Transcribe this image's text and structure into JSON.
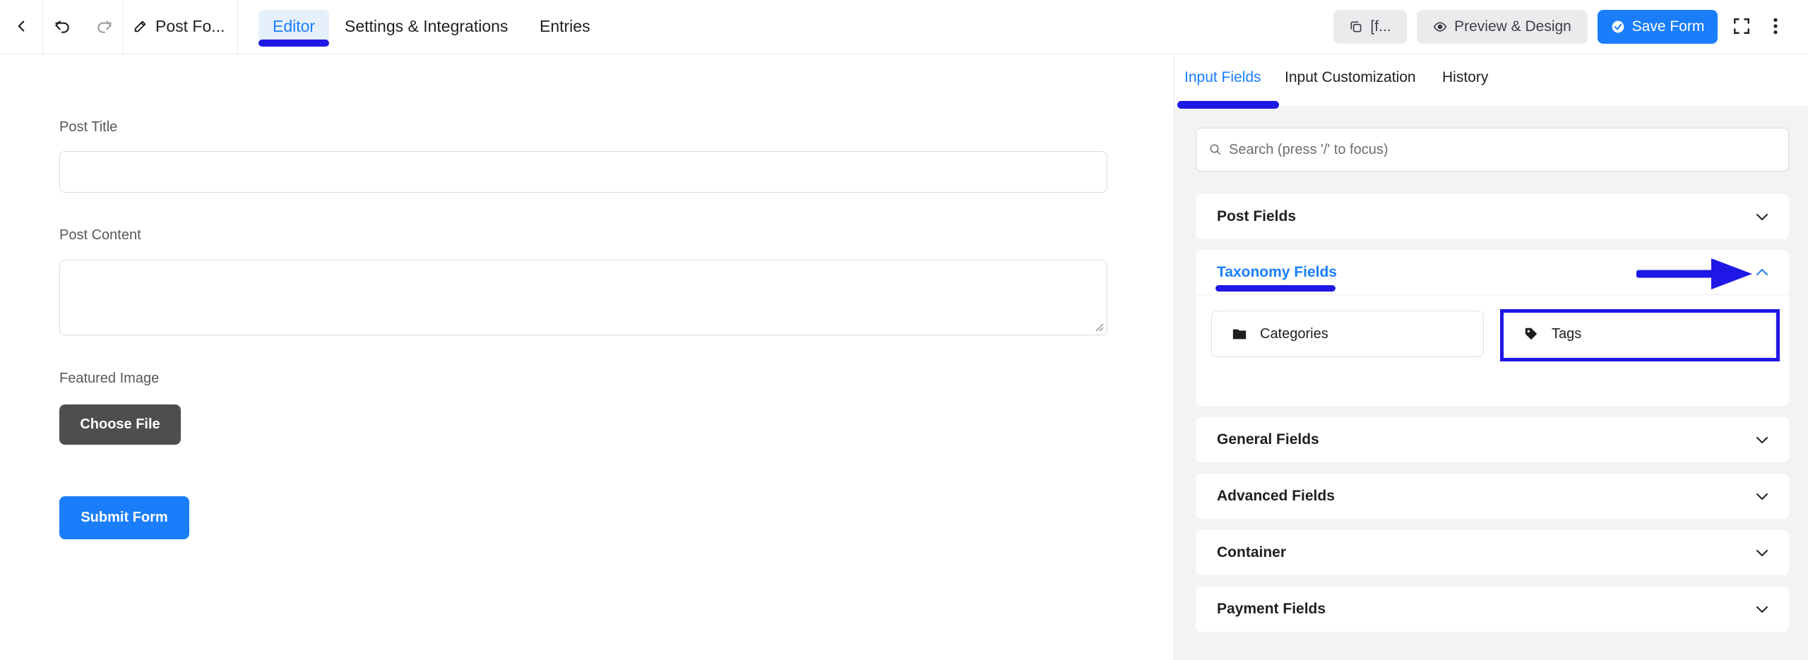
{
  "topbar": {
    "form_title": "Post Fo...",
    "tabs": [
      {
        "label": "Editor",
        "active": true
      },
      {
        "label": "Settings & Integrations",
        "active": false
      },
      {
        "label": "Entries",
        "active": false
      }
    ],
    "shortcode_label": "[f...",
    "preview_label": "Preview & Design",
    "save_label": "Save Form"
  },
  "editor": {
    "fields": [
      {
        "label": "Post Title",
        "type": "text",
        "value": ""
      },
      {
        "label": "Post Content",
        "type": "textarea",
        "value": ""
      },
      {
        "label": "Featured Image",
        "type": "file"
      }
    ],
    "file_button_label": "Choose File",
    "submit_label": "Submit Form"
  },
  "sidebar": {
    "tabs": [
      {
        "label": "Input Fields",
        "active": true
      },
      {
        "label": "Input Customization",
        "active": false
      },
      {
        "label": "History",
        "active": false
      }
    ],
    "search_placeholder": "Search (press '/' to focus)",
    "sections": [
      {
        "title": "Post Fields",
        "expanded": false
      },
      {
        "title": "Taxonomy Fields",
        "expanded": true,
        "items": [
          {
            "label": "Categories",
            "icon": "folder-icon"
          },
          {
            "label": "Tags",
            "icon": "tag-icon",
            "highlighted": true
          }
        ]
      },
      {
        "title": "General Fields",
        "expanded": false
      },
      {
        "title": "Advanced Fields",
        "expanded": false
      },
      {
        "title": "Container",
        "expanded": false
      },
      {
        "title": "Payment Fields",
        "expanded": false
      }
    ]
  },
  "colors": {
    "accent": "#1a7efb",
    "annotation": "#1e17e6",
    "dark_button": "#4d4e50",
    "sidebar_bg": "#f2f3f5"
  }
}
